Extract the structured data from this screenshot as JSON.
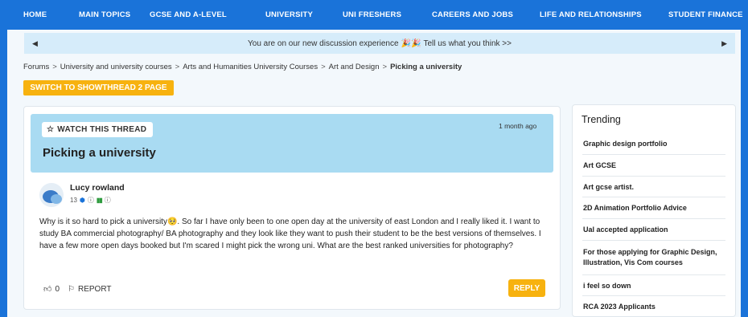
{
  "topnav": {
    "items": [
      "HOME",
      "MAIN TOPICS",
      "GCSE AND A-LEVEL",
      "UNIVERSITY",
      "UNI FRESHERS",
      "CAREERS AND JOBS",
      "LIFE AND RELATIONSHIPS",
      "STUDENT FINANCE"
    ]
  },
  "banner": {
    "text_before": "You are on our new discussion experience",
    "text_after": "Tell us what you think >>",
    "emoji": "🎉🎉"
  },
  "breadcrumb": {
    "items": [
      "Forums",
      "University and university courses",
      "Arts and Humanities University Courses",
      "Art and Design"
    ],
    "current": "Picking a university",
    "separator": ">"
  },
  "switch_button": "SWITCH TO SHOWTHREAD 2 PAGE",
  "thread": {
    "watch_label": "WATCH THIS THREAD",
    "time_ago": "1 month ago",
    "title": "Picking a university"
  },
  "post": {
    "username": "Lucy rowland",
    "reputation": "13",
    "body": "Why is it so hard to pick a university🥺. So far I have only been to one open day at the university of east London and I really liked it. I want to study BA commercial photography/ BA photography and they look like they want to push their student to be the best versions of themselves. I have a few more open days booked but I'm scared I might pick the wrong uni. What are the best ranked universities for photography?",
    "likes": "0",
    "report_label": "REPORT",
    "reply_label": "REPLY"
  },
  "trending": {
    "title": "Trending",
    "items": [
      "Graphic design portfolio",
      "Art GCSE",
      "Art gcse artist.",
      "2D Animation Portfolio Advice",
      "Ual accepted application",
      "For those applying for Graphic Design, Illustration, Vis Com courses",
      "i feel so down",
      "RCA 2023 Applicants"
    ]
  },
  "colors": {
    "nav": "#1a73d9",
    "banner": "#d6ecfa",
    "thread_header": "#a9dbf2",
    "accent": "#f7b20f"
  }
}
